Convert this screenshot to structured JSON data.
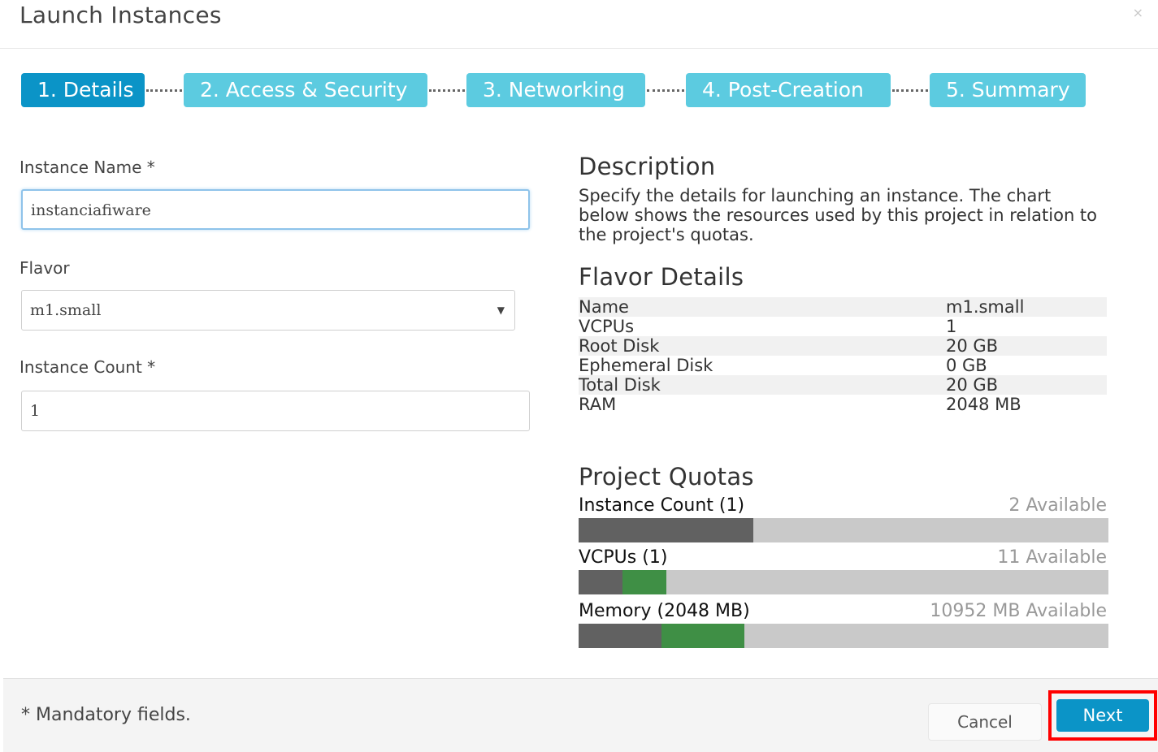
{
  "dialog": {
    "title": "Launch Instances",
    "close_glyph": "×"
  },
  "wizard": {
    "steps": [
      {
        "label": "1. Details",
        "state": "active"
      },
      {
        "label": "2. Access & Security",
        "state": "inactive"
      },
      {
        "label": "3. Networking",
        "state": "inactive"
      },
      {
        "label": "4. Post-Creation",
        "state": "inactive"
      },
      {
        "label": "5. Summary",
        "state": "inactive"
      }
    ]
  },
  "form": {
    "instance_name": {
      "label": "Instance Name *",
      "value": "instanciafiware"
    },
    "flavor": {
      "label": "Flavor",
      "value": "m1.small"
    },
    "instance_count": {
      "label": "Instance Count *",
      "value": "1"
    }
  },
  "description": {
    "heading": "Description",
    "text": "Specify the details for launching an instance. The chart below shows the resources used by this project in relation to the project's quotas."
  },
  "flavor_details": {
    "heading": "Flavor Details",
    "rows": [
      {
        "key": "Name",
        "value": "m1.small"
      },
      {
        "key": "VCPUs",
        "value": "1"
      },
      {
        "key": "Root Disk",
        "value": "20 GB"
      },
      {
        "key": "Ephemeral Disk",
        "value": "0 GB"
      },
      {
        "key": "Total Disk",
        "value": "20 GB"
      },
      {
        "key": "RAM",
        "value": "2048 MB"
      }
    ]
  },
  "project_quotas": {
    "heading": "Project Quotas",
    "items": [
      {
        "label": "Instance Count",
        "amount": "(1)",
        "available": "2 Available",
        "used_fraction": 0.33,
        "added_fraction": 0.0
      },
      {
        "label": "VCPUs",
        "amount": "(1)",
        "available": "11 Available",
        "used_fraction": 0.083,
        "added_fraction": 0.083
      },
      {
        "label": "Memory",
        "amount": "(2048 MB)",
        "available": "10952 MB Available",
        "used_fraction": 0.157,
        "added_fraction": 0.157
      }
    ]
  },
  "footer": {
    "mandatory_note": "* Mandatory fields.",
    "cancel_label": "Cancel",
    "next_label": "Next"
  },
  "colors": {
    "step_active": "#0b94c7",
    "step_inactive": "#5ccbe0",
    "quota_used": "#616161",
    "quota_added": "#3f8f45",
    "quota_track": "#c9c9c9",
    "highlight": "#ff0000"
  }
}
